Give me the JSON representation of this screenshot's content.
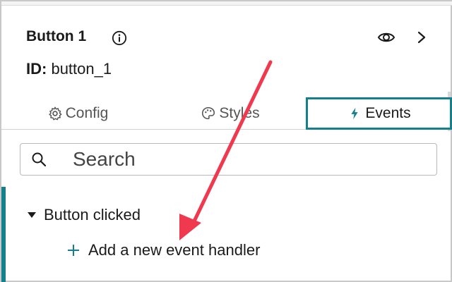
{
  "header": {
    "title": "Button 1",
    "id_key": "ID:",
    "id_value": "button_1",
    "icons": [
      "info-icon",
      "eye-icon",
      "chevron-right-icon"
    ]
  },
  "tabs": [
    {
      "label": "Config",
      "icon": "gear-icon",
      "active": false
    },
    {
      "label": "Styles",
      "icon": "palette-icon",
      "active": false
    },
    {
      "label": "Events",
      "icon": "lightning-icon",
      "active": true
    }
  ],
  "search": {
    "placeholder": "Search"
  },
  "events": {
    "group_label": "Button clicked",
    "expanded": true,
    "add_label": "Add a new event handler"
  },
  "colors": {
    "accent": "#13808c",
    "annotation_arrow": "#f0384f"
  }
}
